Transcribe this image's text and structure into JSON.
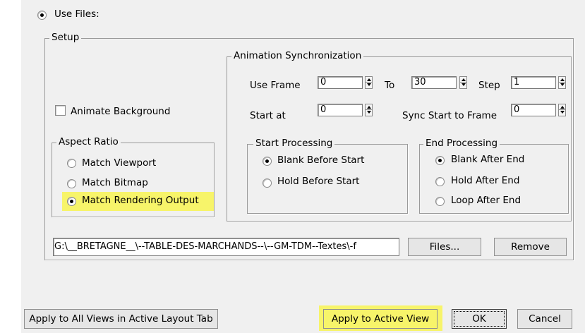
{
  "use_files": {
    "label": "Use Files:"
  },
  "setup": {
    "title": "Setup",
    "animate_background": {
      "label": "Animate Background"
    },
    "aspect_ratio": {
      "title": "Aspect Ratio",
      "options": [
        {
          "label": "Match Viewport",
          "selected": false
        },
        {
          "label": "Match Bitmap",
          "selected": false
        },
        {
          "label": "Match Rendering Output",
          "selected": true
        }
      ]
    },
    "anim_sync": {
      "title": "Animation Synchronization",
      "use_frame_label": "Use Frame",
      "use_frame_value": "0",
      "to_label": "To",
      "to_value": "30",
      "step_label": "Step",
      "step_value": "1",
      "start_at_label": "Start at",
      "start_at_value": "0",
      "sync_start_label": "Sync Start to Frame",
      "sync_start_value": "0",
      "start_processing": {
        "title": "Start Processing",
        "options": [
          {
            "label": "Blank Before Start",
            "selected": true
          },
          {
            "label": "Hold Before Start",
            "selected": false
          }
        ]
      },
      "end_processing": {
        "title": "End Processing",
        "options": [
          {
            "label": "Blank After End",
            "selected": true
          },
          {
            "label": "Hold After End",
            "selected": false
          },
          {
            "label": "Loop After End",
            "selected": false
          }
        ]
      }
    },
    "file_path": "G:\\__BRETAGNE__\\--TABLE-DES-MARCHANDS--\\--GM-TDM--Textes\\-f",
    "files_button": "Files...",
    "remove_button": "Remove"
  },
  "footer": {
    "apply_all": "Apply to All Views in Active Layout Tab",
    "apply_active": "Apply to Active View",
    "ok": "OK",
    "cancel": "Cancel"
  },
  "colors": {
    "highlight": "#f7f46a",
    "panel_bg": "#f0f0f0"
  }
}
